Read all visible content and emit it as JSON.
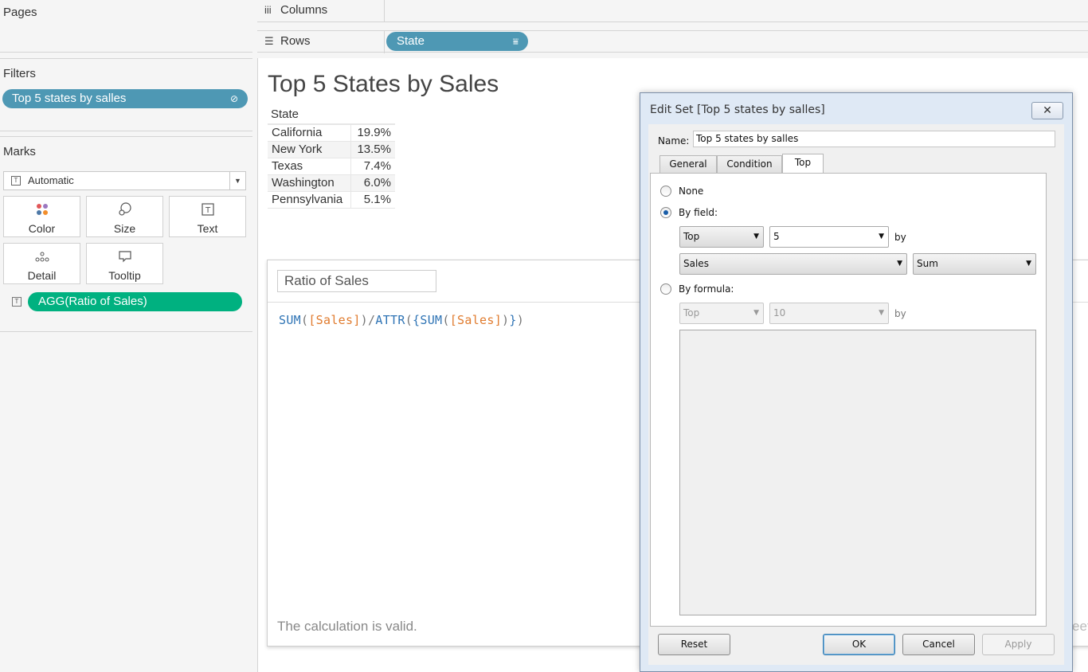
{
  "left_panel": {
    "pages_title": "Pages",
    "filters_title": "Filters",
    "filter_pill": "Top 5 states by salles",
    "marks_title": "Marks",
    "mark_type": "Automatic",
    "mark_buttons": [
      "Color",
      "Size",
      "Text",
      "Detail",
      "Tooltip"
    ],
    "mark_field_pill": "AGG(Ratio of Sales)"
  },
  "shelves": {
    "columns_label": "Columns",
    "rows_label": "Rows",
    "rows_pill": "State"
  },
  "view": {
    "title": "Top 5 States by Sales",
    "table_header": "State",
    "rows": [
      {
        "state": "California",
        "value": "19.9%"
      },
      {
        "state": "New York",
        "value": "13.5%"
      },
      {
        "state": "Texas",
        "value": "7.4%"
      },
      {
        "state": "Washington",
        "value": "6.0%"
      },
      {
        "state": "Pennsylvania",
        "value": "5.1%"
      }
    ]
  },
  "calc_editor": {
    "name": "Ratio of Sales",
    "formula_tokens": [
      "SUM",
      "(",
      "[Sales]",
      ")",
      "/",
      "ATTR",
      "(",
      "{",
      "SUM",
      "(",
      "[Sales]",
      ")",
      "}",
      ")"
    ],
    "status": "The calculation is valid.",
    "ghost_text": "eet"
  },
  "dialog": {
    "title": "Edit Set [Top 5 states by salles]",
    "close_label": "✕",
    "name_label": "Name:",
    "name_value": "Top 5 states by salles",
    "tabs": [
      "General",
      "Condition",
      "Top"
    ],
    "active_tab": "Top",
    "none_label": "None",
    "by_field_label": "By field:",
    "by_field": {
      "direction": "Top",
      "count": "5",
      "by": "by",
      "field": "Sales",
      "aggregation": "Sum"
    },
    "by_formula_label": "By formula:",
    "by_formula": {
      "direction": "Top",
      "count": "10",
      "by": "by"
    },
    "selected_option": "By field",
    "buttons": {
      "reset": "Reset",
      "ok": "OK",
      "cancel": "Cancel",
      "apply": "Apply"
    }
  }
}
